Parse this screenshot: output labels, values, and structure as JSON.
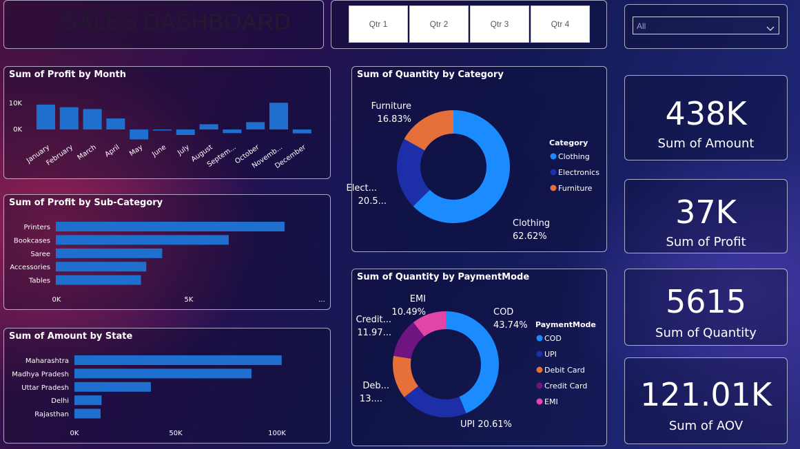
{
  "header": {
    "title": "SALES DASHBOARD"
  },
  "quarter_filter": {
    "buttons": [
      "Qtr 1",
      "Qtr 2",
      "Qtr 3",
      "Qtr 4"
    ]
  },
  "state_filter": {
    "selected": "All"
  },
  "kpis": [
    {
      "value": "438K",
      "label": "Sum of Amount"
    },
    {
      "value": "37K",
      "label": "Sum of Profit"
    },
    {
      "value": "5615",
      "label": "Sum of Quantity"
    },
    {
      "value": "121.01K",
      "label": "Sum of AOV"
    }
  ],
  "colors": {
    "bar": "#1f6fcf",
    "clothing": "#1a8cff",
    "electronics": "#1c2fa8",
    "furniture": "#e5703a",
    "cod": "#1a8cff",
    "upi": "#1c2fa8",
    "debit_card": "#e5703a",
    "credit_card": "#6f1480",
    "emi": "#e245a8"
  },
  "chart_data": [
    {
      "type": "bar",
      "title": "Sum of Profit by Month",
      "categories": [
        "January",
        "February",
        "March",
        "April",
        "May",
        "June",
        "July",
        "August",
        "Septem...",
        "October",
        "Novemb...",
        "December"
      ],
      "values": [
        9500,
        8500,
        7800,
        4200,
        -3800,
        -400,
        -2100,
        2000,
        -1400,
        2800,
        10200,
        -1500
      ],
      "yticks": [
        "10K",
        "0K"
      ],
      "ylim": [
        -5000,
        12000
      ],
      "grid": false
    },
    {
      "type": "bar",
      "orientation": "horizontal",
      "title": "Sum of Profit by Sub-Category",
      "categories": [
        "Printers",
        "Bookcases",
        "Saree",
        "Accessories",
        "Tables"
      ],
      "values": [
        8600,
        6500,
        4000,
        3400,
        3200
      ],
      "xticks": [
        "0K",
        "5K",
        "..."
      ],
      "xlim": [
        0,
        10000
      ],
      "grid": false
    },
    {
      "type": "bar",
      "orientation": "horizontal",
      "title": "Sum of Amount by State",
      "categories": [
        "Maharashtra",
        "Madhya Pradesh",
        "Uttar Pradesh",
        "Delhi",
        "Rajasthan"
      ],
      "values": [
        103000,
        88000,
        38000,
        13500,
        13000
      ],
      "xticks": [
        "0K",
        "50K",
        "100K"
      ],
      "xlim": [
        0,
        100000
      ],
      "grid": false
    },
    {
      "type": "pie",
      "donut": true,
      "title": "Sum of Quantity by Category",
      "legend_title": "Category",
      "legend_position": "right",
      "slices": [
        {
          "name": "Clothing",
          "value": 62.62,
          "label": "Clothing",
          "pct": "62.62%",
          "color": "#1a8cff"
        },
        {
          "name": "Electronics",
          "value": 20.55,
          "label": "Elect...",
          "pct": "20.5...",
          "color": "#1c2fa8"
        },
        {
          "name": "Furniture",
          "value": 16.83,
          "label": "Furniture",
          "pct": "16.83%",
          "color": "#e5703a"
        }
      ]
    },
    {
      "type": "pie",
      "donut": true,
      "title": "Sum of Quantity by PaymentMode",
      "legend_title": "PaymentMode",
      "legend_position": "right",
      "slices": [
        {
          "name": "COD",
          "value": 43.74,
          "label": "COD",
          "pct": "43.74%",
          "color": "#1a8cff"
        },
        {
          "name": "UPI",
          "value": 20.61,
          "label": "UPI 20.61%",
          "pct": "",
          "color": "#1c2fa8"
        },
        {
          "name": "Debit Card",
          "value": 13.19,
          "label": "Deb...",
          "pct": "13....",
          "color": "#e5703a"
        },
        {
          "name": "Credit Card",
          "value": 11.97,
          "label": "Credit...",
          "pct": "11.97...",
          "color": "#6f1480"
        },
        {
          "name": "EMI",
          "value": 10.49,
          "label": "EMI",
          "pct": "10.49%",
          "color": "#e245a8"
        }
      ]
    }
  ]
}
